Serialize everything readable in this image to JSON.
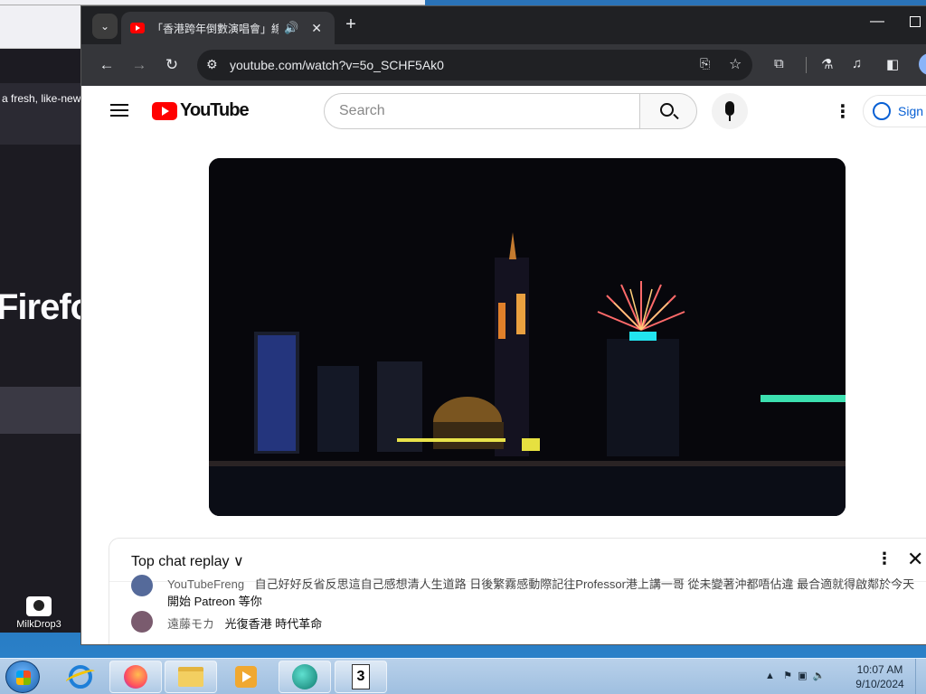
{
  "background_window": {
    "subtitle_fragment": "a fresh, like-new",
    "big_fragment": "Firefo"
  },
  "desktop_icon": {
    "label": "MilkDrop3"
  },
  "browser": {
    "tab": {
      "title": "「香港跨年倒數演唱會」線上",
      "audio_icon": "🔊",
      "close_icon": "✕"
    },
    "new_tab_icon": "+",
    "url": "youtube.com/watch?v=5o_SCHF5Ak0"
  },
  "youtube": {
    "logo_text": "YouTube",
    "search_placeholder": "Search",
    "signin_label": "Sign",
    "more_icon": "⋮"
  },
  "chat": {
    "header": "Top chat replay ∨",
    "more_icon": "⋮",
    "close_icon": "✕",
    "messages": [
      {
        "author": "YouTubeFreng",
        "text": "自己好好反省反思這自己感想清人生道路 日後繁霧感動際記往Professor港上講一哥 從未變著沖都唔佔違 最合適就得啟鄰於今天",
        "text2": "開始 Patreon 等你"
      },
      {
        "author": "遠藤モカ",
        "text": "光復香港 時代革命"
      }
    ]
  },
  "taskbar": {
    "time": "10:07 AM",
    "date": "9/10/2024",
    "app3_label": "3"
  },
  "colors": {
    "youtube_red": "#ff0000",
    "chrome_dark": "#202124",
    "link_blue": "#065fd4"
  }
}
